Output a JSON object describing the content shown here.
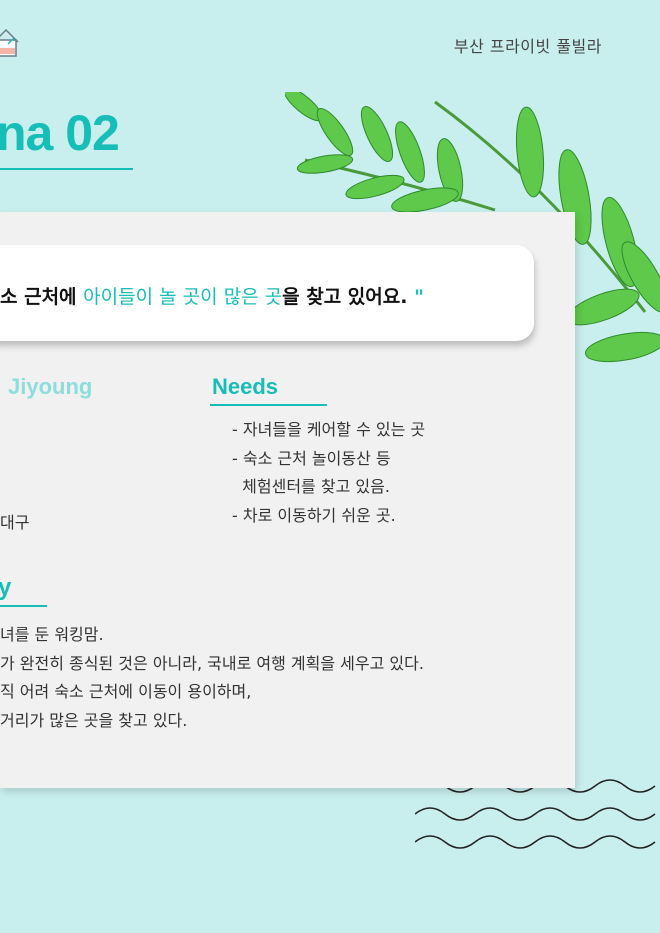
{
  "header": {
    "brand": "부산 프라이빗 풀빌라",
    "logo_icon": "house-icon"
  },
  "title": "na 02",
  "quote": {
    "before": "소 근처에 ",
    "highlight": "아이들이 놀 곳이 많은 곳",
    "after": "을 찾고 있어요.",
    "close_mark": "\""
  },
  "profile": {
    "name_label": "Jiyoung",
    "region": "대구"
  },
  "needs": {
    "label": "Needs",
    "items": [
      "- 자녀들을 케어할 수 있는 곳",
      "- 숙소 근처 놀이동산 등",
      "  체험센터를 찾고 있음.",
      "- 차로 이동하기 쉬운 곳."
    ]
  },
  "story": {
    "label": "y",
    "lines": [
      "녀를 둔 워킹맘.",
      "가 완전히 종식된 것은 아니라, 국내로 여행 계획을 세우고 있다.",
      "직 어려 숙소 근처에 이동이 용이하며,",
      "거리가 많은 곳을 찾고 있다."
    ]
  },
  "colors": {
    "background": "#c8efee",
    "accent": "#17bdb7",
    "card": "#f1f1f1",
    "light_accent": "#8ddedb"
  },
  "decorations": [
    "leaf-branch-icon",
    "wave-lines-icon"
  ]
}
